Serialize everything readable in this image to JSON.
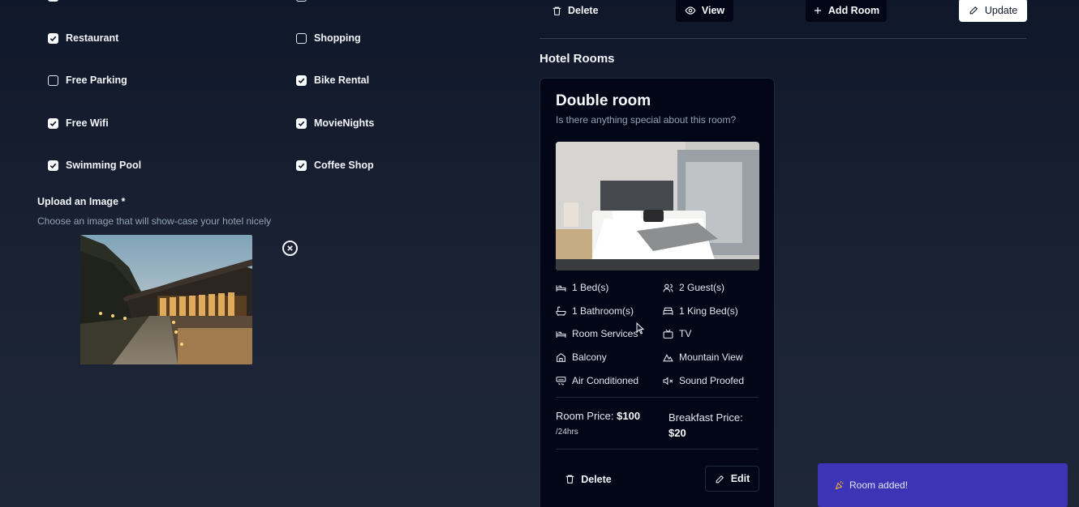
{
  "amenities": [
    {
      "label": "Restaurant",
      "checked": true
    },
    {
      "label": "Shopping",
      "checked": false
    },
    {
      "label": "Free Parking",
      "checked": false
    },
    {
      "label": "Bike Rental",
      "checked": true
    },
    {
      "label": "Free Wifi",
      "checked": true
    },
    {
      "label": "MovieNights",
      "checked": true
    },
    {
      "label": "Swimming Pool",
      "checked": true
    },
    {
      "label": "Coffee Shop",
      "checked": true
    }
  ],
  "upload": {
    "label": "Upload an Image *",
    "description": "Choose an image that will show-case your hotel nicely"
  },
  "toolbar": {
    "delete_label": "Delete",
    "view_label": "View",
    "add_room_label": "Add Room",
    "update_label": "Update"
  },
  "rooms_section": {
    "title": "Hotel Rooms"
  },
  "room": {
    "title": "Double room",
    "description": "Is there anything special about this room?",
    "features": [
      {
        "icon": "bed-icon",
        "label": "1 Bed(s)"
      },
      {
        "icon": "users-icon",
        "label": "2 Guest(s)"
      },
      {
        "icon": "bath-icon",
        "label": "1 Bathroom(s)"
      },
      {
        "icon": "bed-double-icon",
        "label": "1 King Bed(s)"
      },
      {
        "icon": "bed-icon",
        "label": "Room Services"
      },
      {
        "icon": "tv-icon",
        "label": "TV"
      },
      {
        "icon": "home-icon",
        "label": "Balcony"
      },
      {
        "icon": "mountain-icon",
        "label": "Mountain View"
      },
      {
        "icon": "air-vent-icon",
        "label": "Air Conditioned"
      },
      {
        "icon": "volume-x-icon",
        "label": "Sound Proofed"
      }
    ],
    "room_price_label": "Room Price:",
    "room_price_value": "$100",
    "room_price_unit": "/24hrs",
    "breakfast_price_label": "Breakfast Price:",
    "breakfast_price_value": "$20",
    "delete_label": "Delete",
    "edit_label": "Edit"
  },
  "toast": {
    "icon": "party-popper-icon",
    "message": "Room added!"
  },
  "colors": {
    "background": "#0f172a",
    "card": "#020617",
    "toast": "#3b35b5"
  }
}
